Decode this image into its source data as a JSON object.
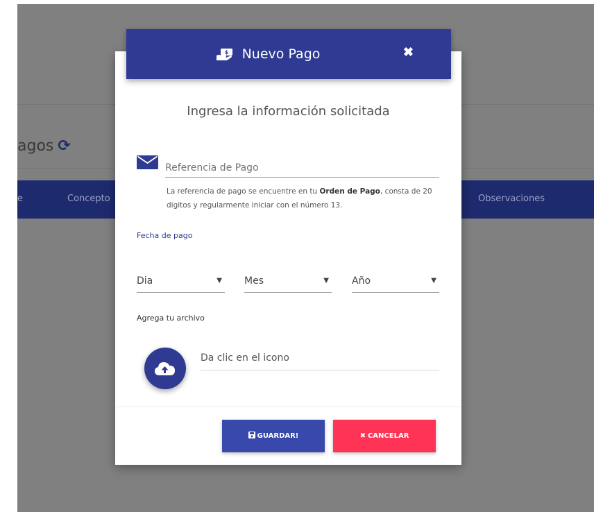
{
  "background": {
    "page_title": "agos",
    "table_columns": [
      "e",
      "Concepto",
      "Observaciones"
    ]
  },
  "modal": {
    "title": "Nuevo Pago",
    "close_label": "✖",
    "subtitle": "Ingresa la información solicitada",
    "reference": {
      "placeholder": "Referencia de Pago",
      "help_prefix": "La referencia de pago se encuentre en tu",
      "help_bold": "Orden de Pago",
      "help_suffix": ", consta de 20 digitos y regularmente iniciar con el número 13."
    },
    "date": {
      "label": "Fecha de pago",
      "day": "Dia",
      "month": "Mes",
      "year": "Año"
    },
    "file": {
      "label": "Agrega tu archivo",
      "hint": "Da clic en el icono"
    },
    "buttons": {
      "save": "GUARDAR!",
      "cancel": "CANCELAR"
    }
  },
  "colors": {
    "primary": "#2f3b93",
    "danger": "#ff3355",
    "backdrop": "#808080"
  }
}
